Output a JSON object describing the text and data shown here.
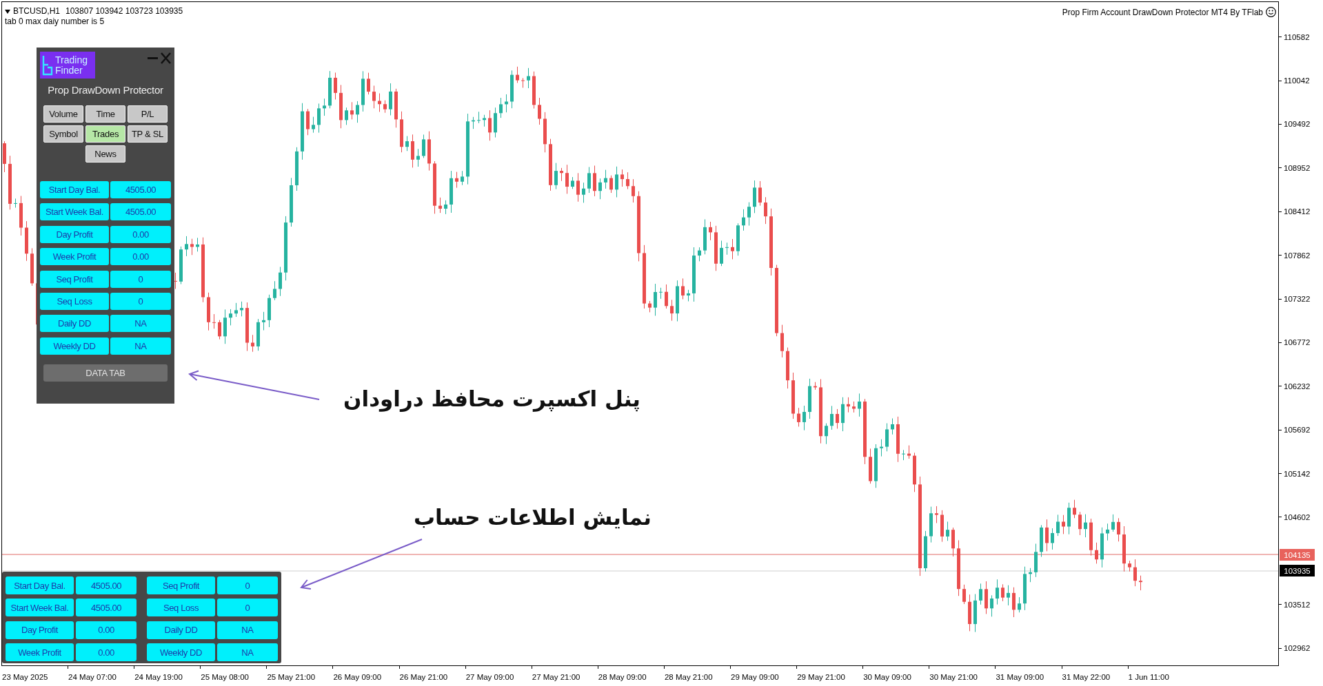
{
  "chart_header": {
    "symbol": "BTCUSD,H1",
    "ohlc": "103807 103942 103723 103935",
    "comment": "tab 0 max daiy number is 5"
  },
  "expert_label": {
    "text": "Prop Firm Account DrawDown Protector MT4 By TFlab"
  },
  "protector_panel": {
    "logo": {
      "line_1": "Trading",
      "line_2": "Finder"
    },
    "title": "Prop DrawDown Protector",
    "tabs": [
      {
        "label": "Volume",
        "selected": false
      },
      {
        "label": "Time",
        "selected": false
      },
      {
        "label": "P/L",
        "selected": false
      },
      {
        "label": "Symbol",
        "selected": false
      },
      {
        "label": "Trades",
        "selected": true
      },
      {
        "label": "TP & SL",
        "selected": false
      },
      {
        "label": "News",
        "selected": false
      }
    ],
    "rows": [
      {
        "label": "Start Day Bal.",
        "value": "4505.00"
      },
      {
        "label": "Start Week Bal.",
        "value": "4505.00"
      },
      {
        "label": "Day Profit",
        "value": "0.00"
      },
      {
        "label": "Week Profit",
        "value": "0.00"
      },
      {
        "label": "Seq Profit",
        "value": "0"
      },
      {
        "label": "Seq Loss",
        "value": "0"
      },
      {
        "label": "Daily DD",
        "value": "NA"
      },
      {
        "label": "Weekly DD",
        "value": "NA"
      }
    ],
    "data_tab_button": "DATA TAB"
  },
  "account_panel": {
    "columns": [
      {
        "rows": [
          {
            "label": "Start Day Bal.",
            "value": "4505.00"
          },
          {
            "label": "Start Week Bal.",
            "value": "4505.00"
          },
          {
            "label": "Day Profit",
            "value": "0.00"
          },
          {
            "label": "Week Profit",
            "value": "0.00"
          }
        ]
      },
      {
        "rows": [
          {
            "label": "Seq Profit",
            "value": "0"
          },
          {
            "label": "Seq Loss",
            "value": "0"
          },
          {
            "label": "Daily DD",
            "value": "NA"
          },
          {
            "label": "Weekly DD",
            "value": "NA"
          }
        ]
      }
    ]
  },
  "annotations": [
    {
      "text": "پنل اکسپرت محافظ دراودان"
    },
    {
      "text": "نمایش اطلاعات حساب"
    }
  ],
  "price_axis": {
    "labels": [
      "110582",
      "110042",
      "109492",
      "108952",
      "108412",
      "107862",
      "107322",
      "106772",
      "106232",
      "105692",
      "105142",
      "104602",
      "103512",
      "102962"
    ],
    "tags": [
      {
        "label": "104135",
        "kind": "level"
      },
      {
        "label": "103935",
        "kind": "bid"
      }
    ]
  },
  "time_axis": {
    "labels": [
      "23 May 2025",
      "24 May 07:00",
      "24 May 19:00",
      "25 May 08:00",
      "25 May 21:00",
      "26 May 09:00",
      "26 May 21:00",
      "27 May 09:00",
      "27 May 21:00",
      "28 May 09:00",
      "28 May 21:00",
      "29 May 09:00",
      "29 May 21:00",
      "30 May 09:00",
      "30 May 21:00",
      "31 May 09:00",
      "31 May 22:00",
      "1 Jun 11:00"
    ]
  }
}
